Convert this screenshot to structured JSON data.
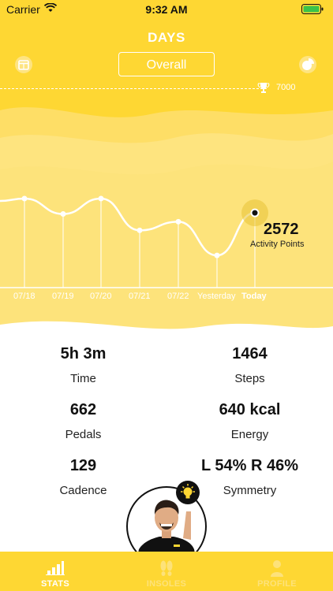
{
  "status_bar": {
    "carrier": "Carrier",
    "time": "9:32 AM"
  },
  "header": {
    "title": "DAYS",
    "filter_label": "Overall"
  },
  "goal": {
    "value": "7000"
  },
  "chart_data": {
    "type": "line",
    "categories": [
      "07/18",
      "07/19",
      "07/20",
      "07/21",
      "07/22",
      "Yesterday",
      "Today"
    ],
    "values": [
      2720,
      2560,
      2720,
      2390,
      2480,
      2130,
      2572
    ],
    "highlight": {
      "value": "2572",
      "label": "Activity Points"
    }
  },
  "stats": {
    "time": {
      "value": "5h 3m",
      "label": "Time"
    },
    "steps": {
      "value": "1464",
      "label": "Steps"
    },
    "pedals": {
      "value": "662",
      "label": "Pedals"
    },
    "energy": {
      "value": "640 kcal",
      "label": "Energy"
    },
    "cadence": {
      "value": "129",
      "label": "Cadence"
    },
    "symmetry": {
      "value": "L 54% R 46%",
      "label": "Symmetry"
    }
  },
  "tabs": [
    {
      "label": "STATS",
      "icon": "bar-chart-icon"
    },
    {
      "label": "INSOLES",
      "icon": "footprints-icon"
    },
    {
      "label": "PROFILE",
      "icon": "person-icon"
    }
  ],
  "colors": {
    "accent": "#fed733",
    "wave_light": "#fee27a",
    "active_tab": "#f1c118"
  }
}
